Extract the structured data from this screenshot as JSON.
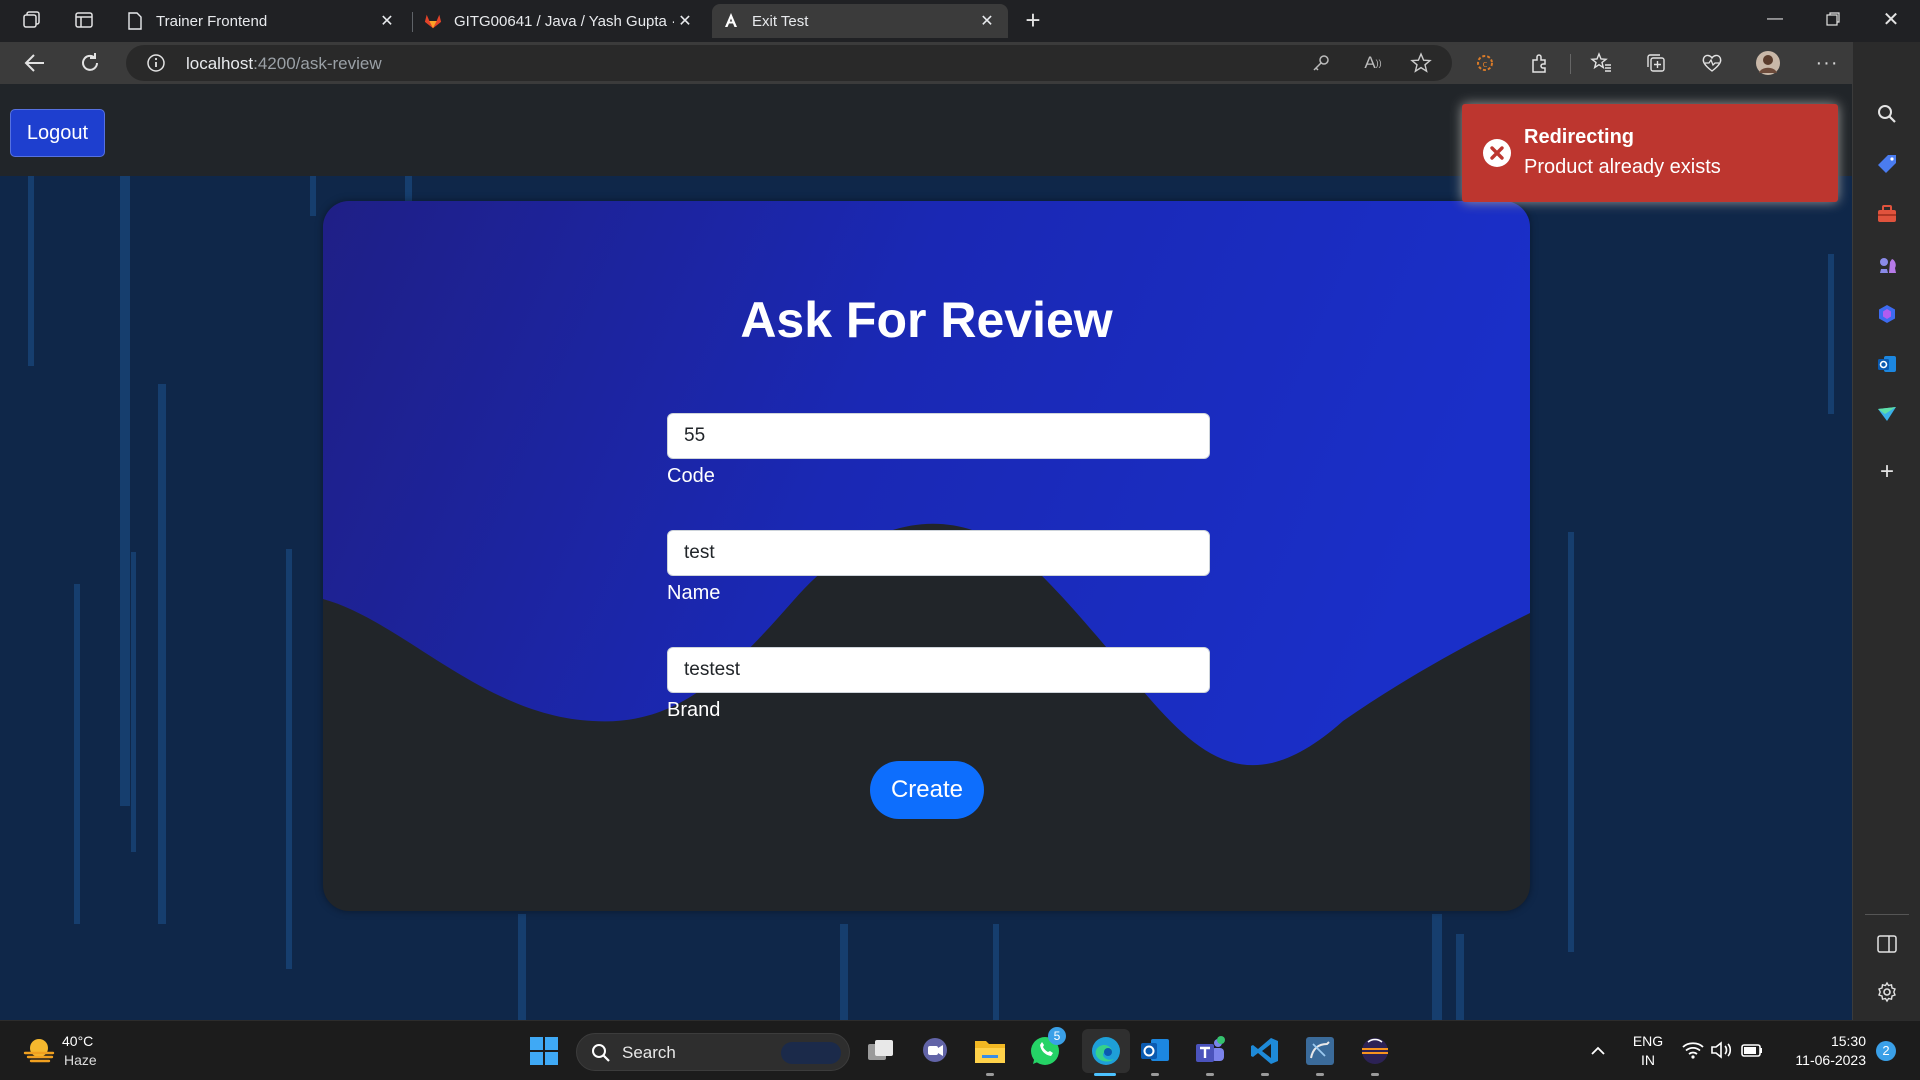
{
  "browser": {
    "tabs": [
      {
        "title": "Trainer Frontend",
        "active": false
      },
      {
        "title": "GITG00641 / Java / Yash Gupta · ",
        "active": false
      },
      {
        "title": "Exit Test",
        "active": true
      }
    ],
    "url_host": "localhost",
    "url_path": ":4200/ask-review"
  },
  "page": {
    "logout_label": "Logout",
    "heading": "Ask For Review",
    "fields": [
      {
        "value": "55",
        "label": "Code"
      },
      {
        "value": "test",
        "label": "Name"
      },
      {
        "value": "testest",
        "label": "Brand"
      }
    ],
    "create_label": "Create"
  },
  "toast": {
    "title": "Redirecting",
    "message": "Product already exists",
    "color": "#bd362f"
  },
  "taskbar": {
    "weather_temp": "40°C",
    "weather_desc": "Haze",
    "search_placeholder": "Search",
    "whatsapp_badge": "5",
    "lang_top": "ENG",
    "lang_bottom": "IN",
    "time": "15:30",
    "date": "11-06-2023",
    "notification_count": "2"
  },
  "colors": {
    "card_wave": "#1a2fc8",
    "primary_button": "#0d6efd",
    "page_background": "#0f2749"
  }
}
